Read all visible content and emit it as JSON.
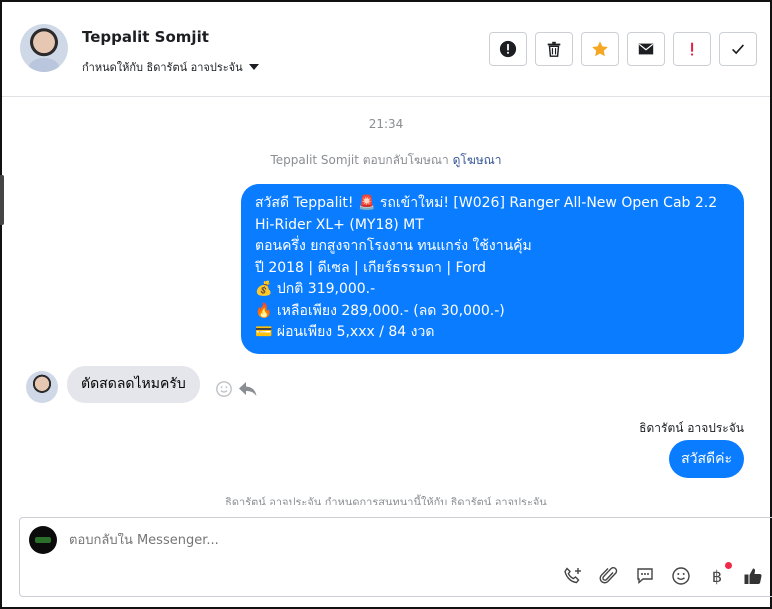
{
  "contact": {
    "name": "Teppalit Somjit",
    "assign_label": "กำหนดให้กับ ธิดารัตน์ อาจประจัน"
  },
  "header_tools": [
    {
      "icon": "alert-circle-icon",
      "color": "#1c1e21"
    },
    {
      "icon": "trash-icon",
      "color": "#1c1e21"
    },
    {
      "icon": "star-icon",
      "color": "#f5a623"
    },
    {
      "icon": "mail-icon",
      "color": "#1c1e21"
    },
    {
      "icon": "exclamation-icon",
      "color": "#e41e3f"
    },
    {
      "icon": "check-icon",
      "color": "#1c1e21"
    }
  ],
  "conversation": {
    "time": "21:34",
    "ad_reply_text": "Teppalit Somjit ตอบกลับโฆษณา",
    "ad_link": "ดูโฆษณา",
    "outgoing_ad_lines": [
      "สวัสดี Teppalit! 🚨 รถเข้าใหม่! [W026] Ranger All-New Open Cab 2.2",
      "Hi-Rider XL+ (MY18) MT",
      "ตอนครึ่ง ยกสูงจากโรงงาน ทนแกร่ง ใช้งานคุ้ม",
      "ปี 2018 | ดีเซล | เกียร์ธรรมดา | Ford",
      "💰 ปกติ 319,000.-",
      "🔥 เหลือเพียง 289,000.- (ลด 30,000.-)",
      "💳 ผ่อนเพียง 5,xxx / 84 งวด"
    ],
    "incoming_message": "ตัดสดลดไหมครับ",
    "sender_name": "ธิดารัตน์ อาจประจัน",
    "reply_message": "สวัสดีค่ะ",
    "system_note": "ธิดารัตน์ อาจประจัน กำหนดการสนทนานี้ให้กับ ธิดารัตน์ อาจประจัน"
  },
  "composer": {
    "placeholder": "ตอบกลับใน Messenger..."
  },
  "colors": {
    "accent": "#0a7cff",
    "incoming_bubble": "#e4e6eb",
    "notification_dot": "#f02849"
  }
}
